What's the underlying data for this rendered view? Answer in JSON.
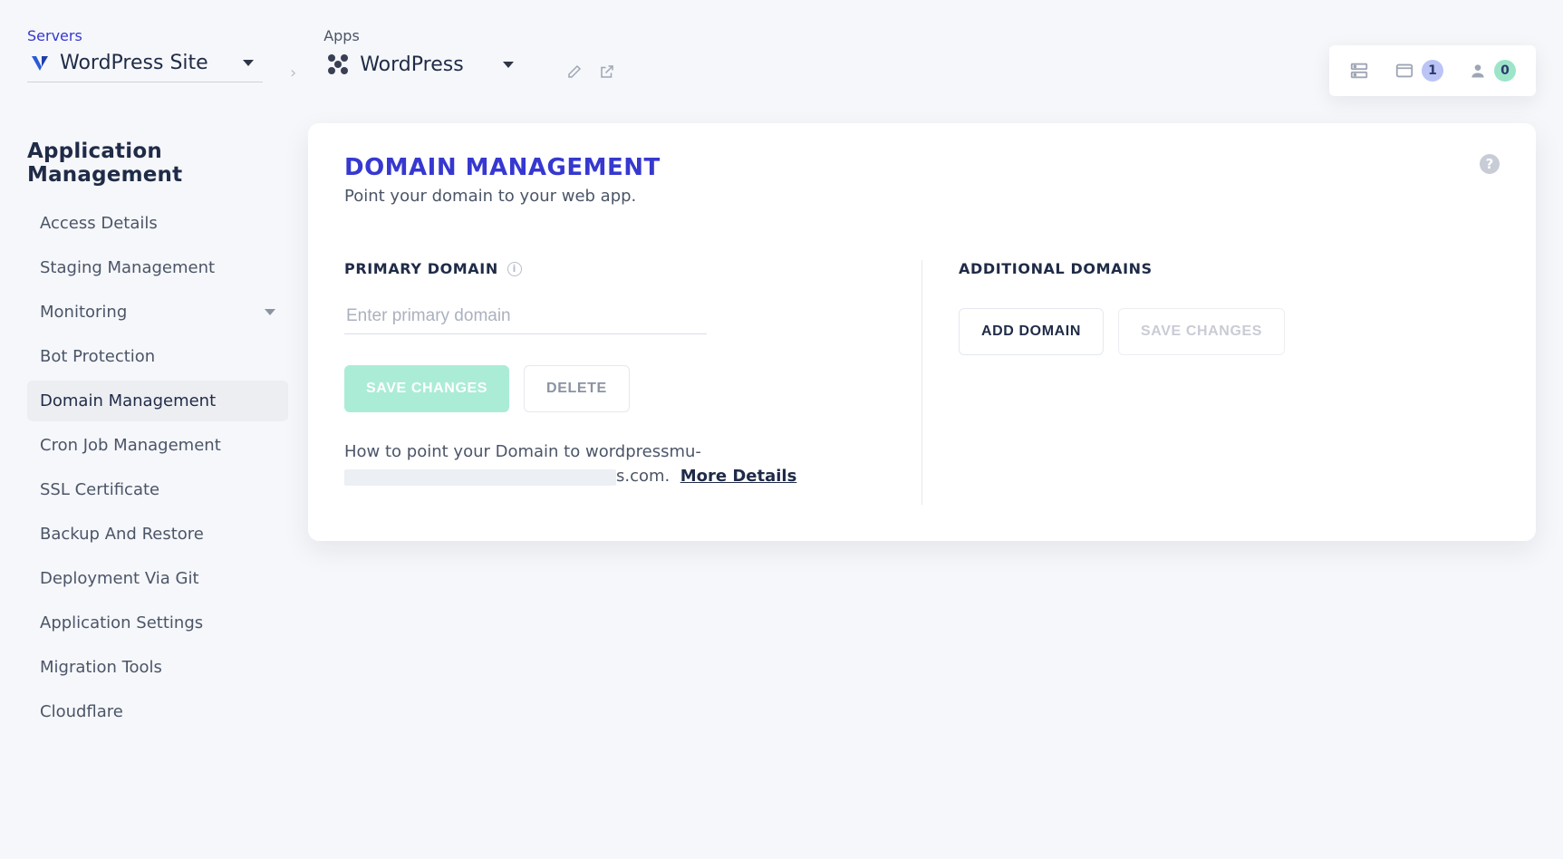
{
  "header": {
    "servers_label": "Servers",
    "server_name": "WordPress Site",
    "apps_label": "Apps",
    "app_name": "WordPress",
    "widget": {
      "server_count": "",
      "page_count": "1",
      "user_count": "0"
    }
  },
  "sidebar": {
    "title": "Application Management",
    "items": [
      {
        "label": "Access Details"
      },
      {
        "label": "Staging Management"
      },
      {
        "label": "Monitoring",
        "expandable": true
      },
      {
        "label": "Bot Protection"
      },
      {
        "label": "Domain Management",
        "active": true
      },
      {
        "label": "Cron Job Management"
      },
      {
        "label": "SSL Certificate"
      },
      {
        "label": "Backup And Restore"
      },
      {
        "label": "Deployment Via Git"
      },
      {
        "label": "Application Settings"
      },
      {
        "label": "Migration Tools"
      },
      {
        "label": "Cloudflare"
      }
    ]
  },
  "panel": {
    "title": "DOMAIN MANAGEMENT",
    "subtitle": "Point your domain to your web app.",
    "primary": {
      "section": "PRIMARY DOMAIN",
      "placeholder": "Enter primary domain",
      "save": "SAVE CHANGES",
      "delete": "DELETE",
      "help_pre": "How to point your Domain to wordpressmu-",
      "help_post": "s.com.",
      "more": "More Details"
    },
    "additional": {
      "section": "ADDITIONAL DOMAINS",
      "add": "ADD DOMAIN",
      "save": "SAVE CHANGES"
    }
  }
}
